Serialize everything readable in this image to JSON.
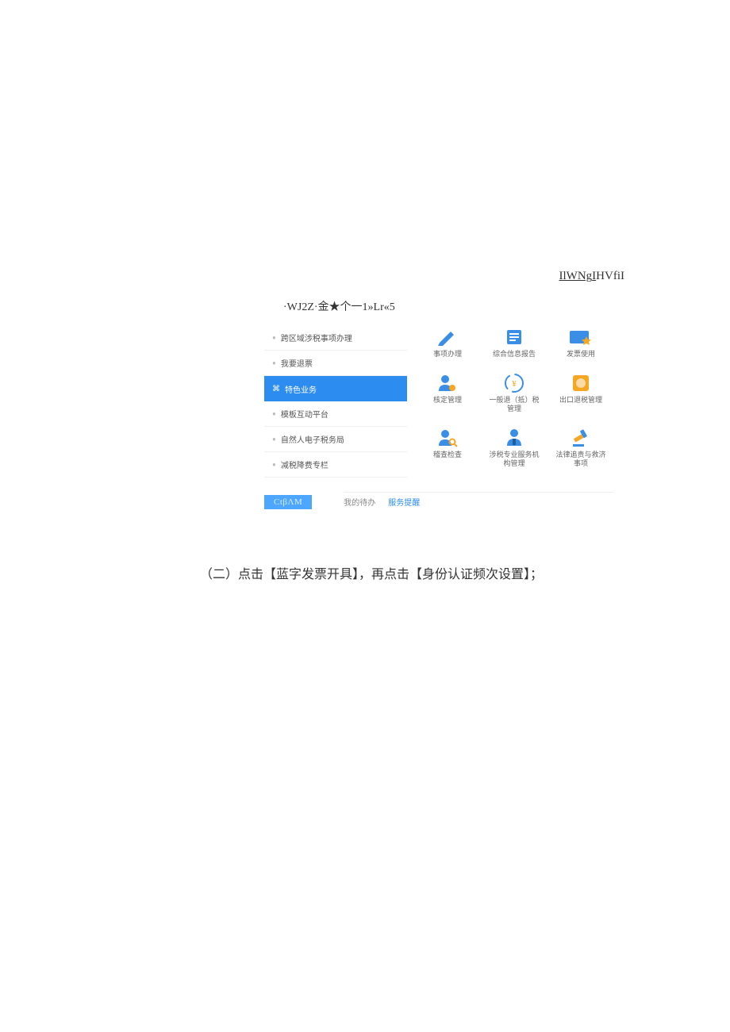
{
  "topLink": {
    "part1": "I",
    "part2": "lWNg",
    "part3": "I",
    "part4": "HVfiI"
  },
  "heading": "·WJ2Z·金★个一1»Lr«5",
  "sidebar": {
    "items": [
      {
        "label": "跨区域涉税事项办理",
        "active": false
      },
      {
        "label": "我要退票",
        "active": false
      },
      {
        "label": "特色业务",
        "active": true
      },
      {
        "label": "模板互动平台",
        "active": false
      },
      {
        "label": "自然人电子税务局",
        "active": false
      },
      {
        "label": "减税降费专栏",
        "active": false
      }
    ],
    "activePrefix": "⌘"
  },
  "grid": {
    "items": [
      {
        "icon": "pencil-icon",
        "label": "事项办理"
      },
      {
        "icon": "list-icon",
        "label": "综合信息报告"
      },
      {
        "icon": "ticket-star-icon",
        "label": "发票使用"
      },
      {
        "icon": "user-gear-icon",
        "label": "核定管理"
      },
      {
        "icon": "refresh-icon",
        "label": "一般退（抵）税管理"
      },
      {
        "icon": "coin-icon",
        "label": "出口退税管理"
      },
      {
        "icon": "user-search-icon",
        "label": "稽查检查"
      },
      {
        "icon": "user-tie-icon",
        "label": "涉税专业服务机构管理"
      },
      {
        "icon": "gavel-icon",
        "label": "法律追责与救济事项"
      }
    ]
  },
  "badge": "CtβΛM",
  "tabs": {
    "items": [
      {
        "label": "我的待办",
        "active": false
      },
      {
        "label": "服务提醒",
        "active": true
      }
    ]
  },
  "instruction": "（二）点击【蓝字发票开具】，再点击【身份认证频次设置】；"
}
